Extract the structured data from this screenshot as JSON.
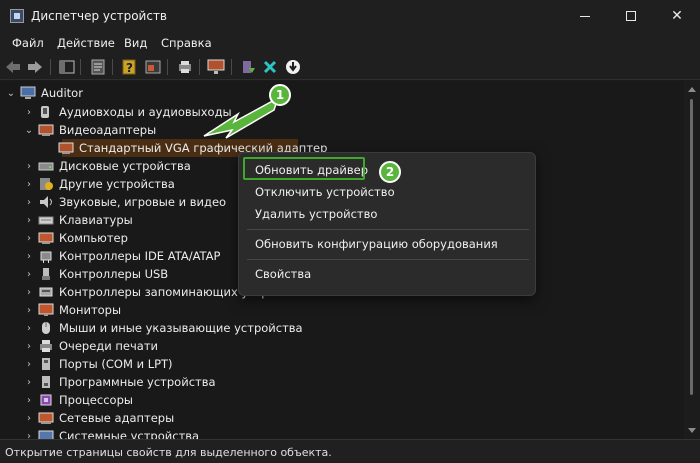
{
  "window": {
    "title": "Диспетчер устройств"
  },
  "menubar": {
    "items": [
      "Файл",
      "Действие",
      "Вид",
      "Справка"
    ]
  },
  "toolbar": {
    "buttons": [
      "back-icon",
      "forward-icon",
      "show-hide-tree-icon",
      "properties-icon",
      "help-icon",
      "view-icon",
      "print-icon",
      "monitor-icon",
      "update-driver-icon",
      "uninstall-icon",
      "download-icon"
    ]
  },
  "tree": {
    "root": "Auditor",
    "items": [
      "Аудиовходы и аудиовыходы",
      "Видеоадаптеры",
      "Стандартный VGA графический адаптер",
      "Дисковые устройства",
      "Другие устройства",
      "Звуковые, игровые и видео",
      "Клавиатуры",
      "Компьютер",
      "Контроллеры IDE ATA/ATAP",
      "Контроллеры USB",
      "Контроллеры запоминающих устройств",
      "Мониторы",
      "Мыши и иные указывающие устройства",
      "Очереди печати",
      "Порты (COM и LPT)",
      "Программные устройства",
      "Процессоры",
      "Сетевые адаптеры",
      "Системные устройства"
    ]
  },
  "context_menu": {
    "items": [
      "Обновить драйвер",
      "Отключить устройство",
      "Удалить устройство",
      "Обновить конфигурацию оборудования",
      "Свойства"
    ]
  },
  "annotations": {
    "badge1": "1",
    "badge2": "2",
    "accent": "#5ab53c"
  },
  "status": {
    "text": "Открытие страницы свойств для выделенного объекта."
  },
  "colors": {
    "selection": "#4a2e14",
    "highlight_border": "#3fa82a"
  }
}
